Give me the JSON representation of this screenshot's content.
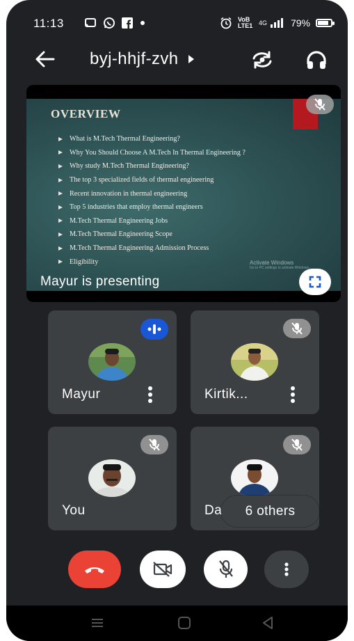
{
  "status_bar": {
    "time": "11:13",
    "network": "VoB LTE1",
    "signal_label": "4G",
    "battery": "79%"
  },
  "top_bar": {
    "meeting_code": "byj-hhjf-zvh"
  },
  "presentation": {
    "slide_title": "OVERVIEW",
    "slide_items": [
      "What is M.Tech Thermal Engineering?",
      "Why You Should Choose A M.Tech In Thermal Engineering ?",
      "Why study M.Tech Thermal Engineering?",
      "The top 3 specialized fields of thermal engineering",
      "Recent innovation in thermal engineering",
      "Top 5 industries that employ thermal engineers",
      "M.Tech Thermal Engineering Jobs",
      "M.Tech Thermal Engineering Scope",
      "M.Tech Thermal Engineering Admission Process",
      "Eligibility"
    ],
    "watermark_title": "Activate Windows",
    "watermark_sub": "Go to PC settings to activate Windows.",
    "presenting_label": "Mayur is presenting"
  },
  "participants": [
    {
      "name": "Mayur",
      "state": "speaking"
    },
    {
      "name": "Kirtik...",
      "state": "muted"
    },
    {
      "name": "You",
      "state": "muted"
    },
    {
      "name": "Dani...",
      "state": "muted"
    }
  ],
  "others_chip": "6 others",
  "colors": {
    "background": "#202124",
    "tile": "#3c4043",
    "end_call": "#ea4335",
    "speaking": "#1a57d6"
  }
}
